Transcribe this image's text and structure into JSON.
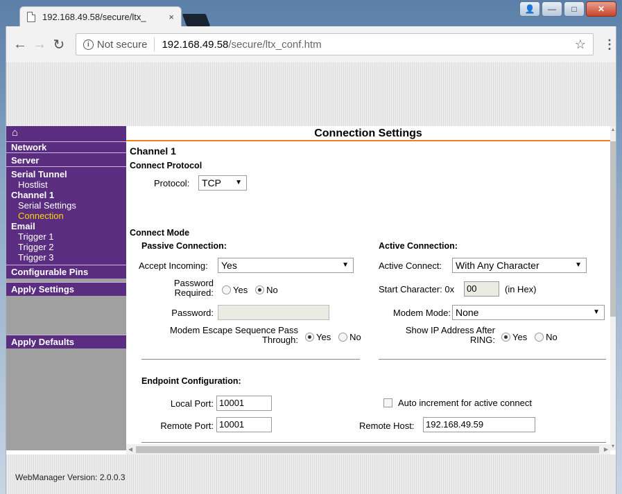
{
  "browser": {
    "tab_title": "192.168.49.58/secure/ltx_",
    "tab_close": "×",
    "security_label": "Not secure",
    "url_host": "192.168.49.58",
    "url_path": "/secure/ltx_conf.htm",
    "window_buttons": {
      "user": "👤",
      "minimize": "—",
      "maximize": "□",
      "close": "✕"
    }
  },
  "sidebar": {
    "home_icon": "⌂",
    "network": "Network",
    "server": "Server",
    "serial_tunnel": "Serial Tunnel",
    "hostlist": "Hostlist",
    "channel1": "Channel 1",
    "serial_settings": "Serial Settings",
    "connection": "Connection",
    "email": "Email",
    "trigger1": "Trigger 1",
    "trigger2": "Trigger 2",
    "trigger3": "Trigger 3",
    "configurable_pins": "Configurable Pins",
    "apply_settings": "Apply Settings",
    "apply_defaults": "Apply Defaults"
  },
  "main": {
    "title": "Connection Settings",
    "channel": "Channel 1",
    "connect_protocol": "Connect Protocol",
    "protocol_label": "Protocol:",
    "protocol_value": "TCP",
    "connect_mode": "Connect Mode",
    "passive": {
      "heading": "Passive Connection:",
      "accept_incoming_label": "Accept Incoming:",
      "accept_incoming_value": "Yes",
      "password_required_label_1": "Password",
      "password_required_label_2": "Required:",
      "password_required": "No",
      "password_label": "Password:",
      "password_value": "",
      "modem_escape_label_1": "Modem Escape Sequence Pass",
      "modem_escape_label_2": "Through:",
      "modem_escape": "Yes"
    },
    "active": {
      "heading": "Active Connection:",
      "active_connect_label": "Active Connect:",
      "active_connect_value": "With Any Character",
      "start_char_label": "Start Character: 0x",
      "start_char_value": "00",
      "start_char_suffix": "(in Hex)",
      "modem_mode_label": "Modem Mode:",
      "modem_mode_value": "None",
      "show_ip_label_1": "Show IP Address After",
      "show_ip_label_2": "RING:",
      "show_ip": "Yes"
    },
    "yes": "Yes",
    "no": "No",
    "endpoint_heading": "Endpoint Configuration:",
    "local_port_label": "Local Port:",
    "local_port_value": "10001",
    "remote_port_label": "Remote Port:",
    "remote_port_value": "10001",
    "auto_increment_label": "Auto increment for active connect",
    "auto_increment_checked": false,
    "remote_host_label": "Remote Host:",
    "remote_host_value": "192.168.49.59"
  },
  "footer": {
    "version": "WebManager Version: 2.0.0.3"
  }
}
